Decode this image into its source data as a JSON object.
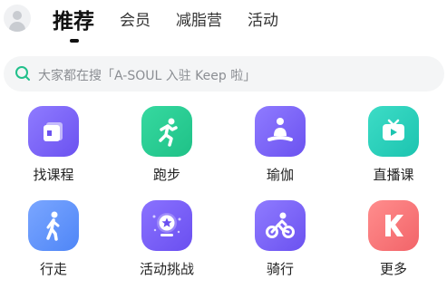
{
  "header": {
    "tabs": [
      {
        "label": "推荐",
        "active": true
      },
      {
        "label": "会员",
        "active": false
      },
      {
        "label": "减脂营",
        "active": false
      },
      {
        "label": "活动",
        "active": false
      }
    ]
  },
  "search": {
    "placeholder": "大家都在搜「A-SOUL 入驻 Keep 啦」"
  },
  "grid": {
    "items": [
      {
        "label": "找课程",
        "icon": "course-book-icon",
        "color_from": "#8f7bff",
        "color_to": "#6b52f0"
      },
      {
        "label": "跑步",
        "icon": "running-person-icon",
        "color_from": "#36d9a0",
        "color_to": "#1fc187"
      },
      {
        "label": "瑜伽",
        "icon": "yoga-pose-icon",
        "color_from": "#8f7bff",
        "color_to": "#6b52f0"
      },
      {
        "label": "直播课",
        "icon": "live-tv-icon",
        "color_from": "#3ddcc6",
        "color_to": "#1cc4b0"
      },
      {
        "label": "行走",
        "icon": "walking-person-icon",
        "color_from": "#7aa6ff",
        "color_to": "#4f86f7"
      },
      {
        "label": "活动挑战",
        "icon": "challenge-medal-icon",
        "color_from": "#8a72ff",
        "color_to": "#6a4ff0"
      },
      {
        "label": "骑行",
        "icon": "cycling-icon",
        "color_from": "#8f7bff",
        "color_to": "#6b52f0"
      },
      {
        "label": "更多",
        "icon": "keep-logo-icon",
        "color_from": "#ff8d8d",
        "color_to": "#f26469"
      }
    ]
  }
}
